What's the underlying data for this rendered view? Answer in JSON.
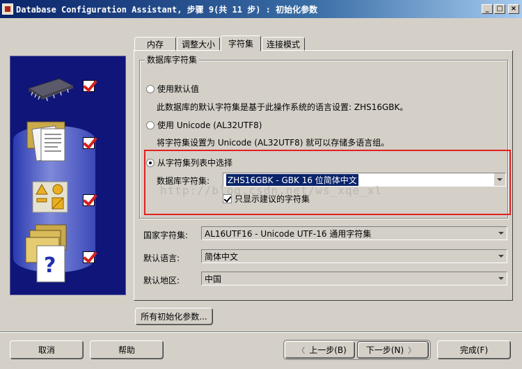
{
  "window": {
    "title": "Database Configuration Assistant, 步骤 9(共 11 步) : 初始化参数",
    "buttons": [
      "_",
      "□",
      "×"
    ]
  },
  "tabs": [
    {
      "label": "内存",
      "active": false
    },
    {
      "label": "调整大小",
      "active": false
    },
    {
      "label": "字符集",
      "active": true
    },
    {
      "label": "连接模式",
      "active": false
    }
  ],
  "charset_group": {
    "legend": "数据库字符集",
    "option_default": {
      "label": "使用默认值",
      "desc": "此数据库的默认字符集是基于此操作系统的语言设置: ZHS16GBK。",
      "selected": false
    },
    "option_unicode": {
      "label": "使用 Unicode (AL32UTF8)",
      "desc": "将字符集设置为 Unicode (AL32UTF8) 就可以存储多语言组。",
      "selected": false
    },
    "option_list": {
      "label": "从字符集列表中选择",
      "selected": true,
      "db_charset_label": "数据库字符集:",
      "db_charset_value": "ZHS16GBK - GBK 16 位简体中文",
      "show_recommended_label": "只显示建议的字符集",
      "show_recommended_checked": true
    }
  },
  "watermark": "http://blog.csdn.net/ws_xqe_xl",
  "national_charset": {
    "label": "国家字符集:",
    "value": "AL16UTF16 - Unicode UTF-16 通用字符集"
  },
  "default_language": {
    "label": "默认语言:",
    "value": "简体中文"
  },
  "default_territory": {
    "label": "默认地区:",
    "value": "中国"
  },
  "all_params_button": "所有初始化参数...",
  "footer": {
    "cancel": "取消",
    "help": "帮助",
    "back": "上一步(B)",
    "next": "下一步(N)",
    "finish": "完成(F)"
  },
  "colors": {
    "highlight": "#e02020",
    "panel_bg": "#10157a",
    "window_bg": "#d4d0c8",
    "title_bar": "#0a246a"
  },
  "stage_icons": [
    "chip-icon",
    "documents-icon",
    "shapes-icon",
    "help-document-icon"
  ]
}
